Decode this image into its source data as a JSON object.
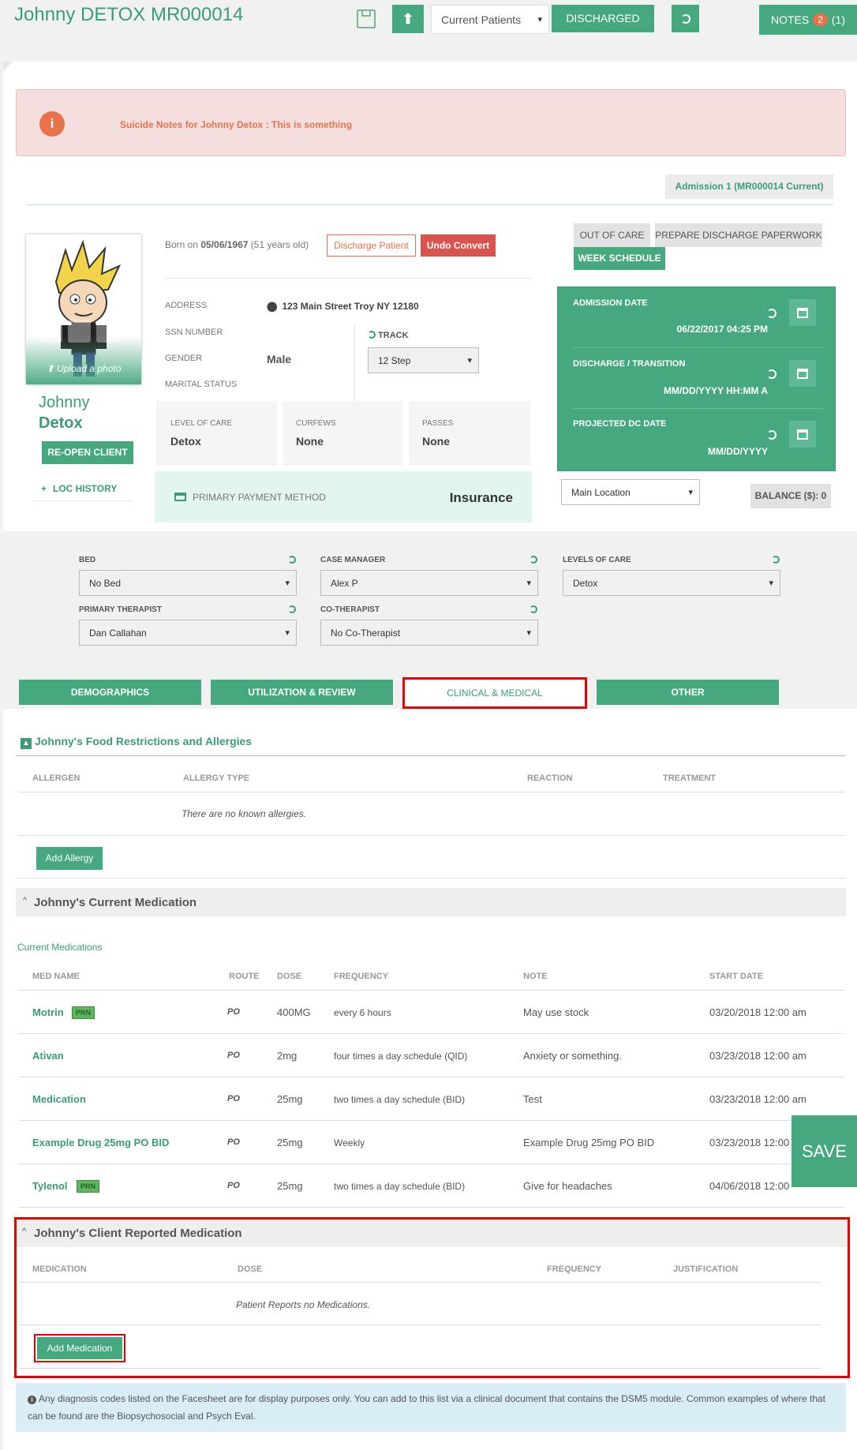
{
  "header": {
    "title": "Johnny DETOX MR000014",
    "patient_filter": "Current Patients",
    "discharged_label": "DISCHARGED",
    "notes_label": "NOTES",
    "notes_badge": "2",
    "notes_count": "(1)"
  },
  "alert": {
    "text": "Suicide Notes for Johnny Detox : This is something"
  },
  "admission_badge": "Admission 1 (MR000014 Current)",
  "profile": {
    "upload_label": "Upload a photo",
    "first_name": "Johnny",
    "last_name": "Detox",
    "reopen_label": "RE-OPEN CLIENT",
    "loc_history_label": "LOC HISTORY",
    "born_prefix": "Born on",
    "born_date": "05/06/1967",
    "age_text": "(51 years old)",
    "discharge_btn": "Discharge Patient",
    "undo_btn": "Undo Convert"
  },
  "details": {
    "address_label": "ADDRESS",
    "address_value": "123 Main Street Troy NY 12180",
    "ssn_label": "SSN NUMBER",
    "gender_label": "GENDER",
    "gender_value": "Male",
    "marital_label": "MARITAL STATUS",
    "track_label": "TRACK",
    "track_value": "12 Step"
  },
  "boxes": [
    {
      "label": "LEVEL OF CARE",
      "value": "Detox"
    },
    {
      "label": "CURFEWS",
      "value": "None"
    },
    {
      "label": "PASSES",
      "value": "None"
    }
  ],
  "payment": {
    "label": "PRIMARY PAYMENT METHOD",
    "value": "Insurance"
  },
  "actions": {
    "out_of_care": "OUT OF CARE",
    "prepare": "PREPARE DISCHARGE PAPERWORK",
    "week": "WEEK SCHEDULE"
  },
  "dates": {
    "admission_label": "ADMISSION DATE",
    "admission_value": "06/22/2017 04:25 PM",
    "discharge_label": "DISCHARGE / TRANSITION",
    "discharge_value": "MM/DD/YYYY HH:MM A",
    "projected_label": "PROJECTED DC DATE",
    "projected_value": "MM/DD/YYYY"
  },
  "location": "Main Location",
  "balance": "BALANCE ($): 0",
  "assign": {
    "bed_label": "BED",
    "bed_value": "No Bed",
    "cm_label": "CASE MANAGER",
    "cm_value": "Alex P",
    "loc_label": "LEVELS OF CARE",
    "loc_value": "Detox",
    "pt_label": "PRIMARY THERAPIST",
    "pt_value": "Dan Callahan",
    "ct_label": "CO-THERAPIST",
    "ct_value": "No Co-Therapist"
  },
  "tabs": [
    "DEMOGRAPHICS",
    "UTILIZATION & REVIEW",
    "CLINICAL & MEDICAL",
    "OTHER"
  ],
  "allergies": {
    "title": "Johnny's Food Restrictions and Allergies",
    "headers": [
      "ALLERGEN",
      "ALLERGY TYPE",
      "REACTION",
      "TREATMENT"
    ],
    "empty": "There are no known allergies.",
    "add_label": "Add Allergy"
  },
  "current_meds": {
    "title": "Johnny's Current Medication",
    "subtitle": "Current Medications",
    "headers": [
      "MED NAME",
      "ROUTE",
      "DOSE",
      "FREQUENCY",
      "NOTE",
      "START DATE"
    ],
    "prn_label": "PRN",
    "rows": [
      {
        "name": "Motrin",
        "route": "PO",
        "dose": "400MG",
        "freq": "every 6 hours",
        "note": "May use stock",
        "start": "03/20/2018 12:00 am"
      },
      {
        "name": "Ativan",
        "route": "PO",
        "dose": "2mg",
        "freq": "four times a day schedule (QID)",
        "note": "Anxiety or something.",
        "start": "03/23/2018 12:00 am"
      },
      {
        "name": "Medication",
        "route": "PO",
        "dose": "25mg",
        "freq": "two times a day schedule (BID)",
        "note": "Test",
        "start": "03/23/2018 12:00 am"
      },
      {
        "name": "Example Drug 25mg PO BID",
        "route": "PO",
        "dose": "25mg",
        "freq": "Weekly",
        "note": "Example Drug 25mg PO BID",
        "start": "03/23/2018 12:00"
      },
      {
        "name": "Tylenol",
        "route": "PO",
        "dose": "25mg",
        "freq": "two times a day schedule (BID)",
        "note": "Give for headaches",
        "start": "04/06/2018 12:00"
      }
    ]
  },
  "save_label": "SAVE",
  "reported_meds": {
    "title": "Johnny's Client Reported Medication",
    "headers": [
      "MEDICATION",
      "DOSE",
      "FREQUENCY",
      "JUSTIFICATION"
    ],
    "empty": "Patient Reports no Medications.",
    "add_label": "Add Medication"
  },
  "footer_note": "Any diagnosis codes listed on the Facesheet are for display purposes only. You can add to this list via a clinical document that contains the DSM5 module. Common examples of where that can be found are the Biopsychosocial and Psych Eval."
}
